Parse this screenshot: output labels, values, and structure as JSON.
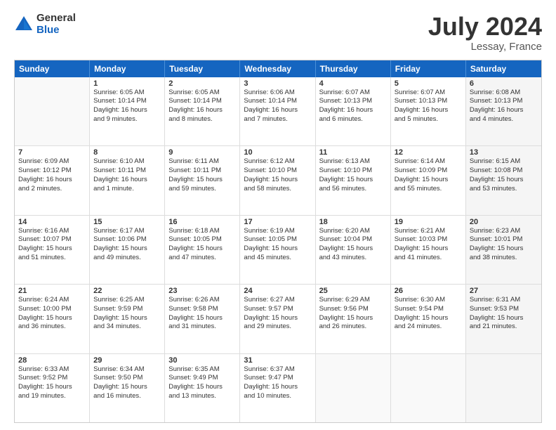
{
  "header": {
    "logo_general": "General",
    "logo_blue": "Blue",
    "title": "July 2024",
    "location": "Lessay, France"
  },
  "weekdays": [
    "Sunday",
    "Monday",
    "Tuesday",
    "Wednesday",
    "Thursday",
    "Friday",
    "Saturday"
  ],
  "rows": [
    [
      {
        "day": "",
        "lines": [],
        "empty": true
      },
      {
        "day": "1",
        "lines": [
          "Sunrise: 6:05 AM",
          "Sunset: 10:14 PM",
          "Daylight: 16 hours",
          "and 9 minutes."
        ]
      },
      {
        "day": "2",
        "lines": [
          "Sunrise: 6:05 AM",
          "Sunset: 10:14 PM",
          "Daylight: 16 hours",
          "and 8 minutes."
        ]
      },
      {
        "day": "3",
        "lines": [
          "Sunrise: 6:06 AM",
          "Sunset: 10:14 PM",
          "Daylight: 16 hours",
          "and 7 minutes."
        ]
      },
      {
        "day": "4",
        "lines": [
          "Sunrise: 6:07 AM",
          "Sunset: 10:13 PM",
          "Daylight: 16 hours",
          "and 6 minutes."
        ]
      },
      {
        "day": "5",
        "lines": [
          "Sunrise: 6:07 AM",
          "Sunset: 10:13 PM",
          "Daylight: 16 hours",
          "and 5 minutes."
        ]
      },
      {
        "day": "6",
        "lines": [
          "Sunrise: 6:08 AM",
          "Sunset: 10:13 PM",
          "Daylight: 16 hours",
          "and 4 minutes."
        ],
        "shaded": true
      }
    ],
    [
      {
        "day": "7",
        "lines": [
          "Sunrise: 6:09 AM",
          "Sunset: 10:12 PM",
          "Daylight: 16 hours",
          "and 2 minutes."
        ]
      },
      {
        "day": "8",
        "lines": [
          "Sunrise: 6:10 AM",
          "Sunset: 10:11 PM",
          "Daylight: 16 hours",
          "and 1 minute."
        ]
      },
      {
        "day": "9",
        "lines": [
          "Sunrise: 6:11 AM",
          "Sunset: 10:11 PM",
          "Daylight: 15 hours",
          "and 59 minutes."
        ]
      },
      {
        "day": "10",
        "lines": [
          "Sunrise: 6:12 AM",
          "Sunset: 10:10 PM",
          "Daylight: 15 hours",
          "and 58 minutes."
        ]
      },
      {
        "day": "11",
        "lines": [
          "Sunrise: 6:13 AM",
          "Sunset: 10:10 PM",
          "Daylight: 15 hours",
          "and 56 minutes."
        ]
      },
      {
        "day": "12",
        "lines": [
          "Sunrise: 6:14 AM",
          "Sunset: 10:09 PM",
          "Daylight: 15 hours",
          "and 55 minutes."
        ]
      },
      {
        "day": "13",
        "lines": [
          "Sunrise: 6:15 AM",
          "Sunset: 10:08 PM",
          "Daylight: 15 hours",
          "and 53 minutes."
        ],
        "shaded": true
      }
    ],
    [
      {
        "day": "14",
        "lines": [
          "Sunrise: 6:16 AM",
          "Sunset: 10:07 PM",
          "Daylight: 15 hours",
          "and 51 minutes."
        ]
      },
      {
        "day": "15",
        "lines": [
          "Sunrise: 6:17 AM",
          "Sunset: 10:06 PM",
          "Daylight: 15 hours",
          "and 49 minutes."
        ]
      },
      {
        "day": "16",
        "lines": [
          "Sunrise: 6:18 AM",
          "Sunset: 10:05 PM",
          "Daylight: 15 hours",
          "and 47 minutes."
        ]
      },
      {
        "day": "17",
        "lines": [
          "Sunrise: 6:19 AM",
          "Sunset: 10:05 PM",
          "Daylight: 15 hours",
          "and 45 minutes."
        ]
      },
      {
        "day": "18",
        "lines": [
          "Sunrise: 6:20 AM",
          "Sunset: 10:04 PM",
          "Daylight: 15 hours",
          "and 43 minutes."
        ]
      },
      {
        "day": "19",
        "lines": [
          "Sunrise: 6:21 AM",
          "Sunset: 10:03 PM",
          "Daylight: 15 hours",
          "and 41 minutes."
        ]
      },
      {
        "day": "20",
        "lines": [
          "Sunrise: 6:23 AM",
          "Sunset: 10:01 PM",
          "Daylight: 15 hours",
          "and 38 minutes."
        ],
        "shaded": true
      }
    ],
    [
      {
        "day": "21",
        "lines": [
          "Sunrise: 6:24 AM",
          "Sunset: 10:00 PM",
          "Daylight: 15 hours",
          "and 36 minutes."
        ]
      },
      {
        "day": "22",
        "lines": [
          "Sunrise: 6:25 AM",
          "Sunset: 9:59 PM",
          "Daylight: 15 hours",
          "and 34 minutes."
        ]
      },
      {
        "day": "23",
        "lines": [
          "Sunrise: 6:26 AM",
          "Sunset: 9:58 PM",
          "Daylight: 15 hours",
          "and 31 minutes."
        ]
      },
      {
        "day": "24",
        "lines": [
          "Sunrise: 6:27 AM",
          "Sunset: 9:57 PM",
          "Daylight: 15 hours",
          "and 29 minutes."
        ]
      },
      {
        "day": "25",
        "lines": [
          "Sunrise: 6:29 AM",
          "Sunset: 9:56 PM",
          "Daylight: 15 hours",
          "and 26 minutes."
        ]
      },
      {
        "day": "26",
        "lines": [
          "Sunrise: 6:30 AM",
          "Sunset: 9:54 PM",
          "Daylight: 15 hours",
          "and 24 minutes."
        ]
      },
      {
        "day": "27",
        "lines": [
          "Sunrise: 6:31 AM",
          "Sunset: 9:53 PM",
          "Daylight: 15 hours",
          "and 21 minutes."
        ],
        "shaded": true
      }
    ],
    [
      {
        "day": "28",
        "lines": [
          "Sunrise: 6:33 AM",
          "Sunset: 9:52 PM",
          "Daylight: 15 hours",
          "and 19 minutes."
        ]
      },
      {
        "day": "29",
        "lines": [
          "Sunrise: 6:34 AM",
          "Sunset: 9:50 PM",
          "Daylight: 15 hours",
          "and 16 minutes."
        ]
      },
      {
        "day": "30",
        "lines": [
          "Sunrise: 6:35 AM",
          "Sunset: 9:49 PM",
          "Daylight: 15 hours",
          "and 13 minutes."
        ]
      },
      {
        "day": "31",
        "lines": [
          "Sunrise: 6:37 AM",
          "Sunset: 9:47 PM",
          "Daylight: 15 hours",
          "and 10 minutes."
        ]
      },
      {
        "day": "",
        "lines": [],
        "empty": true
      },
      {
        "day": "",
        "lines": [],
        "empty": true
      },
      {
        "day": "",
        "lines": [],
        "empty": true,
        "shaded": true
      }
    ]
  ]
}
